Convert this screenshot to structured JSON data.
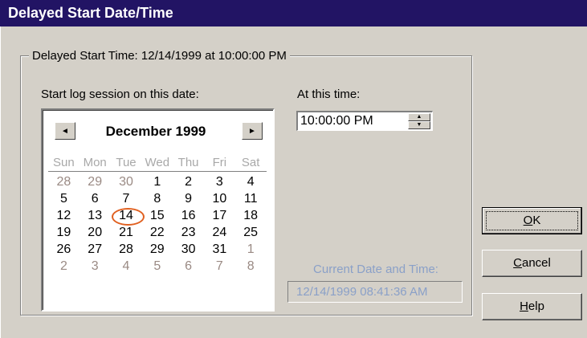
{
  "window": {
    "title": "Delayed Start Date/Time"
  },
  "group": {
    "legend": "Delayed Start Time: 12/14/1999 at 10:00:00 PM"
  },
  "date_label": "Start log session on this date:",
  "time_label": "At this time:",
  "calendar": {
    "month_title": "December 1999",
    "prev_symbol": "◄",
    "next_symbol": "►",
    "day_names": [
      "Sun",
      "Mon",
      "Tue",
      "Wed",
      "Thu",
      "Fri",
      "Sat"
    ],
    "weeks": [
      [
        "28",
        "29",
        "30",
        "1",
        "2",
        "3",
        "4"
      ],
      [
        "5",
        "6",
        "7",
        "8",
        "9",
        "10",
        "11"
      ],
      [
        "12",
        "13",
        "14",
        "15",
        "16",
        "17",
        "18"
      ],
      [
        "19",
        "20",
        "21",
        "22",
        "23",
        "24",
        "25"
      ],
      [
        "26",
        "27",
        "28",
        "29",
        "30",
        "31",
        "1"
      ],
      [
        "2",
        "3",
        "4",
        "5",
        "6",
        "7",
        "8"
      ]
    ],
    "selected_day": "14"
  },
  "time_value": "10:00:00 PM",
  "current": {
    "label": "Current Date and Time:",
    "value": "12/14/1999 08:41:36 AM"
  },
  "buttons": {
    "ok": {
      "accel": "O",
      "rest": "K"
    },
    "cancel": {
      "accel": "C",
      "rest": "ancel"
    },
    "help": {
      "accel": "H",
      "rest": "elp"
    }
  },
  "colors": {
    "title_bar": "#221464",
    "selection_circle": "#e06020",
    "disabled_text": "#8aa0c8"
  }
}
